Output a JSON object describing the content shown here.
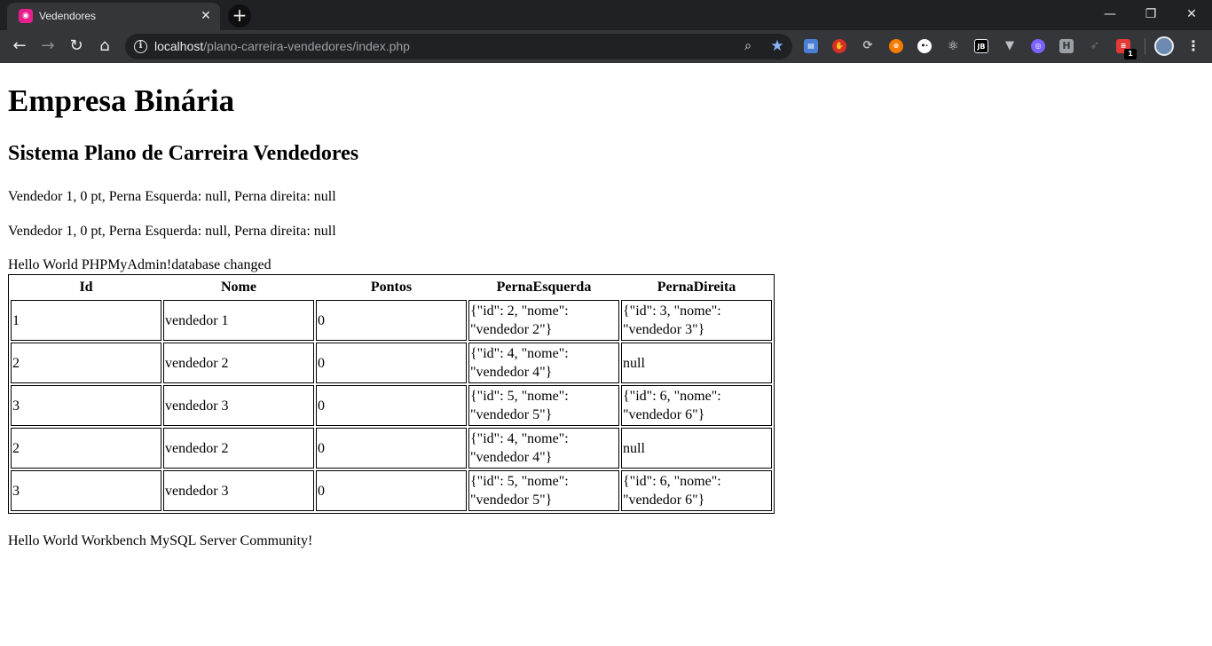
{
  "browser": {
    "tab_title": "Vedendores",
    "url_host": "localhost",
    "url_path": "/plano-carreira-vendedores/index.php",
    "extension_badge": "1",
    "extension_labels": {
      "jb": "JB",
      "h": "H"
    }
  },
  "page": {
    "h1": "Empresa Binária",
    "h2": "Sistema Plano de Carreira Vendedores",
    "line1": "Vendedor 1, 0 pt, Perna Esquerda: null, Perna direita: null",
    "line2": "Vendedor 1, 0 pt, Perna Esquerda: null, Perna direita: null",
    "line3": "Hello World PHPMyAdmin!database changed",
    "footer_line": "Hello World Workbench MySQL Server Community!"
  },
  "table": {
    "headers": [
      "Id",
      "Nome",
      "Pontos",
      "PernaEsquerda",
      "PernaDireita"
    ],
    "rows": [
      [
        "1",
        "vendedor 1",
        "0",
        "{\"id\": 2, \"nome\": \"vendedor 2\"}",
        "{\"id\": 3, \"nome\": \"vendedor 3\"}"
      ],
      [
        "2",
        "vendedor 2",
        "0",
        "{\"id\": 4, \"nome\": \"vendedor 4\"}",
        "null"
      ],
      [
        "3",
        "vendedor 3",
        "0",
        "{\"id\": 5, \"nome\": \"vendedor 5\"}",
        "{\"id\": 6, \"nome\": \"vendedor 6\"}"
      ],
      [
        "2",
        "vendedor 2",
        "0",
        "{\"id\": 4, \"nome\": \"vendedor 4\"}",
        "null"
      ],
      [
        "3",
        "vendedor 3",
        "0",
        "{\"id\": 5, \"nome\": \"vendedor 5\"}",
        "{\"id\": 6, \"nome\": \"vendedor 6\"}"
      ]
    ]
  }
}
